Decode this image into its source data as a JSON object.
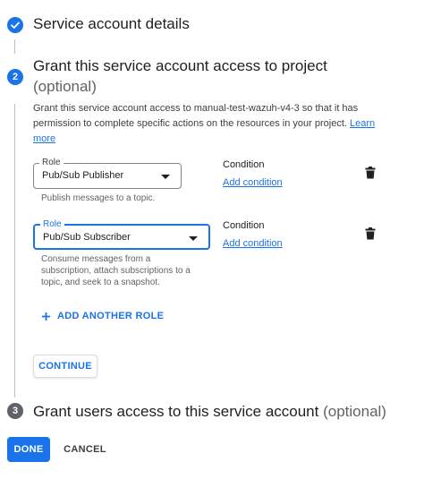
{
  "step1": {
    "title": "Service account details"
  },
  "step2": {
    "number": "2",
    "title": "Grant this service account access to project",
    "optional": "(optional)",
    "description": "Grant this service account access to manual-test-wazuh-v4-3 so that it has permission to complete specific actions on the resources in your project.",
    "learn_more": "Learn more",
    "roles": [
      {
        "label": "Role",
        "value": "Pub/Sub Publisher",
        "helper": "Publish messages to a topic.",
        "condition_label": "Condition",
        "condition_link": "Add condition"
      },
      {
        "label": "Role",
        "value": "Pub/Sub Subscriber",
        "helper": "Consume messages from a subscription, attach subscriptions to a topic, and seek to a snapshot.",
        "condition_label": "Condition",
        "condition_link": "Add condition"
      }
    ],
    "add_role": "ADD ANOTHER ROLE",
    "continue": "CONTINUE"
  },
  "step3": {
    "number": "3",
    "title": "Grant users access to this service account",
    "optional": "(optional)"
  },
  "footer": {
    "done": "DONE",
    "cancel": "CANCEL"
  },
  "colors": {
    "accent": "#1a73e8",
    "muted": "#5f6368",
    "text": "#202124"
  },
  "icons": {
    "step1": "check-icon",
    "delete": "trash-icon",
    "add": "plus-icon",
    "select": "caret-down-icon"
  }
}
